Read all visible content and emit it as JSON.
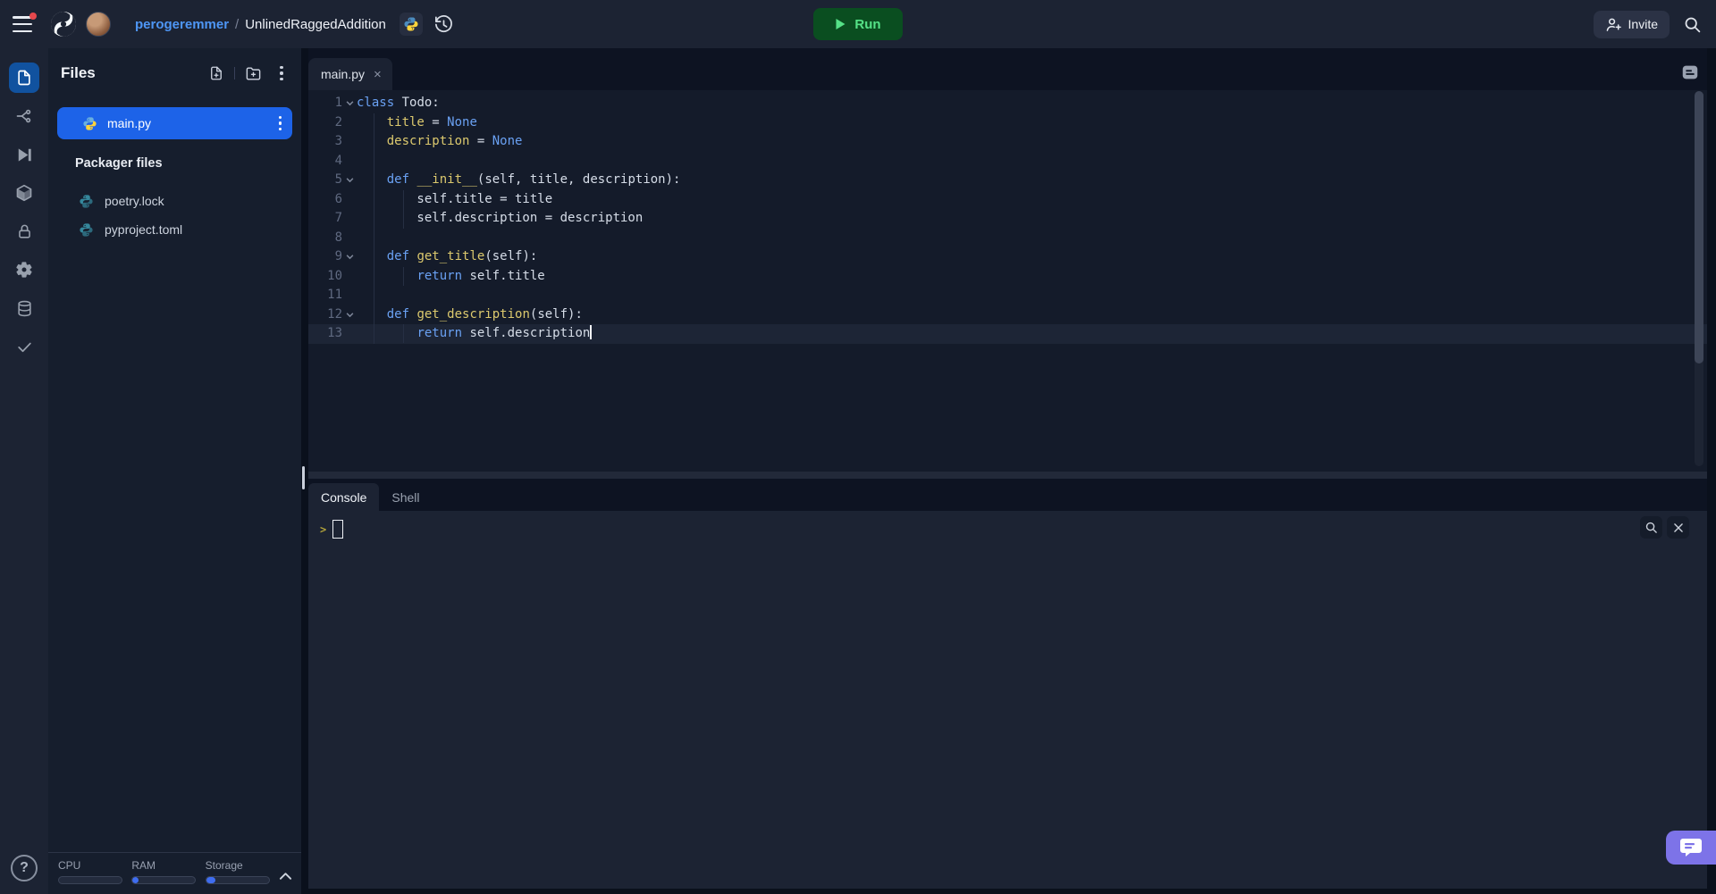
{
  "colors": {
    "accent_blue": "#1d63e8",
    "rail_active_blue": "#11529f",
    "run_green_bg": "#0a4e20",
    "run_green_text": "#55e287",
    "chat_purple": "#7d73e8",
    "python_teal": "#35879b",
    "link_blue": "#4e96f5",
    "keyword_blue": "#6aa1f3",
    "symbol_yellow": "#dcc96e",
    "prompt_yellow": "#b3a43a"
  },
  "topbar": {
    "owner": "perogeremmer",
    "separator": "/",
    "repl_name": "UnlinedRaggedAddition",
    "run_label": "Run",
    "invite_label": "Invite"
  },
  "rail": {
    "items": [
      {
        "name": "files",
        "active": true
      },
      {
        "name": "version-control",
        "active": false
      },
      {
        "name": "run-config",
        "active": false
      },
      {
        "name": "packages",
        "active": false
      },
      {
        "name": "secrets",
        "active": false
      },
      {
        "name": "settings",
        "active": false
      },
      {
        "name": "database",
        "active": false
      },
      {
        "name": "checks",
        "active": false
      }
    ],
    "help_label": "?"
  },
  "files_panel": {
    "title": "Files",
    "selected_file": "main.py",
    "section_title": "Packager files",
    "packager_files": [
      {
        "name": "poetry.lock"
      },
      {
        "name": "pyproject.toml"
      }
    ]
  },
  "editor": {
    "tab_label": "main.py",
    "tab_close": "×",
    "lines": [
      {
        "n": 1,
        "fold": true,
        "tokens": [
          {
            "t": "class",
            "c": "k"
          },
          {
            "t": " Todo:",
            "c": "p"
          }
        ]
      },
      {
        "n": 2,
        "fold": false,
        "tokens": [
          {
            "t": "    ",
            "c": "p"
          },
          {
            "t": "title",
            "c": "v"
          },
          {
            "t": " = ",
            "c": "p"
          },
          {
            "t": "None",
            "c": "k"
          }
        ]
      },
      {
        "n": 3,
        "fold": false,
        "tokens": [
          {
            "t": "    ",
            "c": "p"
          },
          {
            "t": "description",
            "c": "v"
          },
          {
            "t": " = ",
            "c": "p"
          },
          {
            "t": "None",
            "c": "k"
          }
        ]
      },
      {
        "n": 4,
        "fold": false,
        "tokens": []
      },
      {
        "n": 5,
        "fold": true,
        "tokens": [
          {
            "t": "    ",
            "c": "p"
          },
          {
            "t": "def",
            "c": "k"
          },
          {
            "t": " ",
            "c": "p"
          },
          {
            "t": "__init__",
            "c": "f"
          },
          {
            "t": "(self, title, description):",
            "c": "p"
          }
        ]
      },
      {
        "n": 6,
        "fold": false,
        "tokens": [
          {
            "t": "        self.title = title",
            "c": "p"
          }
        ]
      },
      {
        "n": 7,
        "fold": false,
        "tokens": [
          {
            "t": "        self.description = description",
            "c": "p"
          }
        ]
      },
      {
        "n": 8,
        "fold": false,
        "tokens": []
      },
      {
        "n": 9,
        "fold": true,
        "tokens": [
          {
            "t": "    ",
            "c": "p"
          },
          {
            "t": "def",
            "c": "k"
          },
          {
            "t": " ",
            "c": "p"
          },
          {
            "t": "get_title",
            "c": "f"
          },
          {
            "t": "(self):",
            "c": "p"
          }
        ]
      },
      {
        "n": 10,
        "fold": false,
        "tokens": [
          {
            "t": "        ",
            "c": "p"
          },
          {
            "t": "return",
            "c": "k"
          },
          {
            "t": " self.title",
            "c": "p"
          }
        ]
      },
      {
        "n": 11,
        "fold": false,
        "tokens": []
      },
      {
        "n": 12,
        "fold": true,
        "tokens": [
          {
            "t": "    ",
            "c": "p"
          },
          {
            "t": "def",
            "c": "k"
          },
          {
            "t": " ",
            "c": "p"
          },
          {
            "t": "get_description",
            "c": "f"
          },
          {
            "t": "(self):",
            "c": "p"
          }
        ]
      },
      {
        "n": 13,
        "fold": false,
        "active": true,
        "cursor": true,
        "tokens": [
          {
            "t": "        ",
            "c": "p"
          },
          {
            "t": "return",
            "c": "k"
          },
          {
            "t": " self.description",
            "c": "p"
          }
        ]
      }
    ]
  },
  "console": {
    "tabs": [
      {
        "label": "Console",
        "active": true
      },
      {
        "label": "Shell",
        "active": false
      }
    ],
    "prompt": ">"
  },
  "resources": {
    "cpu_label": "CPU",
    "ram_label": "RAM",
    "storage_label": "Storage",
    "cpu_pct": 0,
    "ram_pct": 10,
    "storage_pct": 15
  }
}
